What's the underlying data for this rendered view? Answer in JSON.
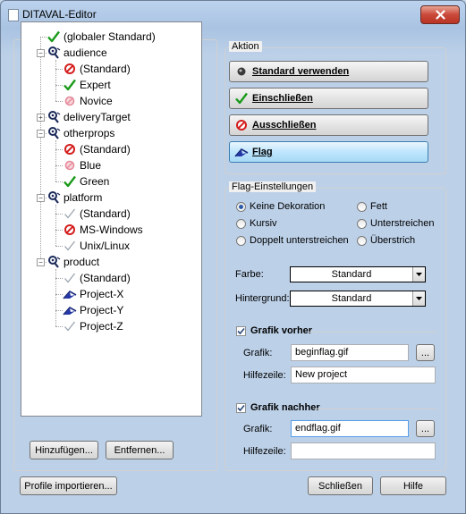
{
  "window": {
    "title": "DITAVAL-Editor"
  },
  "tree": {
    "items": [
      {
        "label": "(globaler Standard)",
        "icon": "check-icon",
        "depth": 0
      },
      {
        "label": "audience",
        "icon": "attribute-icon",
        "depth": 0,
        "expander": "-"
      },
      {
        "label": "(Standard)",
        "icon": "exclude-icon",
        "depth": 1
      },
      {
        "label": "Expert",
        "icon": "check-icon",
        "depth": 1
      },
      {
        "label": "Novice",
        "icon": "exclude-faded-icon",
        "depth": 1
      },
      {
        "label": "deliveryTarget",
        "icon": "attribute-icon",
        "depth": 0,
        "expander": "+"
      },
      {
        "label": "otherprops",
        "icon": "attribute-icon",
        "depth": 0,
        "expander": "-"
      },
      {
        "label": "(Standard)",
        "icon": "exclude-icon",
        "depth": 1
      },
      {
        "label": "Blue",
        "icon": "exclude-faded-icon",
        "depth": 1
      },
      {
        "label": "Green",
        "icon": "check-icon",
        "depth": 1
      },
      {
        "label": "platform",
        "icon": "attribute-icon",
        "depth": 0,
        "expander": "-"
      },
      {
        "label": "(Standard)",
        "icon": "check-faded-icon",
        "depth": 1
      },
      {
        "label": "MS-Windows",
        "icon": "exclude-icon",
        "depth": 1
      },
      {
        "label": "Unix/Linux",
        "icon": "check-faded-icon",
        "depth": 1
      },
      {
        "label": "product",
        "icon": "attribute-icon",
        "depth": 0,
        "expander": "-"
      },
      {
        "label": "(Standard)",
        "icon": "check-faded-icon",
        "depth": 1
      },
      {
        "label": "Project-X",
        "icon": "flag-icon",
        "depth": 1
      },
      {
        "label": "Project-Y",
        "icon": "flag-icon",
        "depth": 1
      },
      {
        "label": "Project-Z",
        "icon": "check-faded-icon",
        "depth": 1
      }
    ]
  },
  "tree_buttons": {
    "add": "Hinzufügen...",
    "remove": "Entfernen..."
  },
  "footer": {
    "import": "Profile importieren...",
    "close": "Schließen",
    "help": "Hilfe"
  },
  "action": {
    "title": "Aktion",
    "buttons": [
      {
        "label": "Standard verwenden",
        "icon": "default-dot-icon",
        "active": false
      },
      {
        "label": "Einschließen",
        "icon": "check-icon",
        "active": false
      },
      {
        "label": "Ausschließen",
        "icon": "exclude-icon",
        "active": false
      },
      {
        "label": "Flag",
        "icon": "flag-icon",
        "active": true
      }
    ]
  },
  "flag": {
    "title": "Flag-Einstellungen",
    "radios": [
      {
        "label": "Keine Dekoration",
        "checked": true
      },
      {
        "label": "Fett",
        "checked": false
      },
      {
        "label": "Kursiv",
        "checked": false
      },
      {
        "label": "Unterstreichen",
        "checked": false
      },
      {
        "label": "Doppelt unterstreichen",
        "checked": false
      },
      {
        "label": "Überstrich",
        "checked": false
      }
    ],
    "color_label": "Farbe:",
    "color_value": "Standard",
    "bg_label": "Hintergrund:",
    "bg_value": "Standard",
    "before": {
      "label": "Grafik vorher",
      "checked": true,
      "graphic_label": "Grafik:",
      "graphic_value": "beginflag.gif",
      "help_label": "Hilfezeile:",
      "help_value": "New project",
      "browse": "..."
    },
    "after": {
      "label": "Grafik nachher",
      "checked": true,
      "graphic_label": "Grafik:",
      "graphic_value": "endflag.gif",
      "help_label": "Hilfezeile:",
      "help_value": "",
      "browse": "..."
    }
  },
  "colors": {
    "accent": "#2a5da8",
    "check": "#1a9a1a",
    "exclude": "#d41e1e"
  }
}
